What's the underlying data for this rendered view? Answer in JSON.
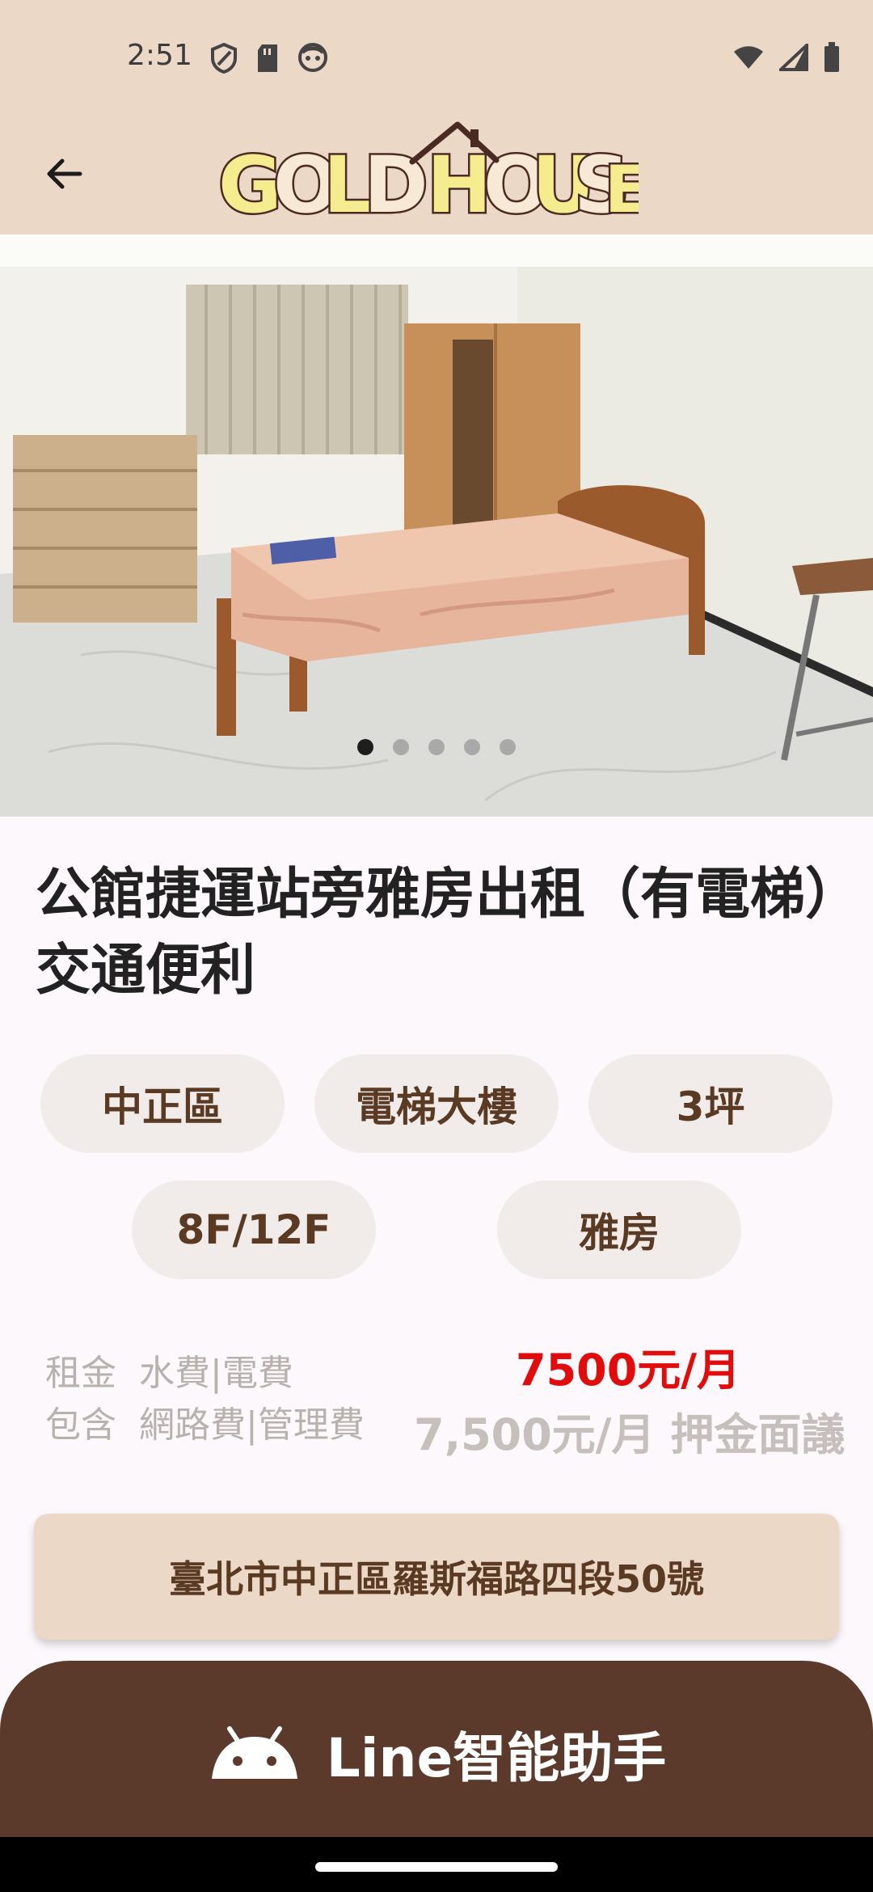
{
  "status": {
    "time": "2:51",
    "left_icons": [
      "shield-icon",
      "sd-card-icon",
      "face-icon"
    ],
    "right_icons": [
      "wifi-icon",
      "signal-icon",
      "battery-icon"
    ]
  },
  "header": {
    "logo_text": "GOLD HOUSE",
    "back_icon": "arrow-left-icon"
  },
  "gallery": {
    "image_count": 5,
    "active_index": 0
  },
  "listing": {
    "title": "公館捷運站旁雅房出租（有電梯）交通便利",
    "tags": [
      "中正區",
      "電梯大樓",
      "3坪",
      "8F/12F",
      "雅房"
    ],
    "rent": {
      "label_1": "租金",
      "label_2": "包含",
      "includes_1": "水費|電費",
      "includes_2": "網路費|管理費",
      "price": "7500元/月",
      "price_detail": "7,500元/月 押金面議"
    },
    "address": "臺北市中正區羅斯福路四段50號"
  },
  "bottom_action": {
    "icon": "android-icon",
    "label": "Line智能助手"
  },
  "colors": {
    "header_bg": "#ecd8c6",
    "brown": "#5b3a2b",
    "price_red": "#e10d0d",
    "chip_bg": "#f1ecea"
  }
}
